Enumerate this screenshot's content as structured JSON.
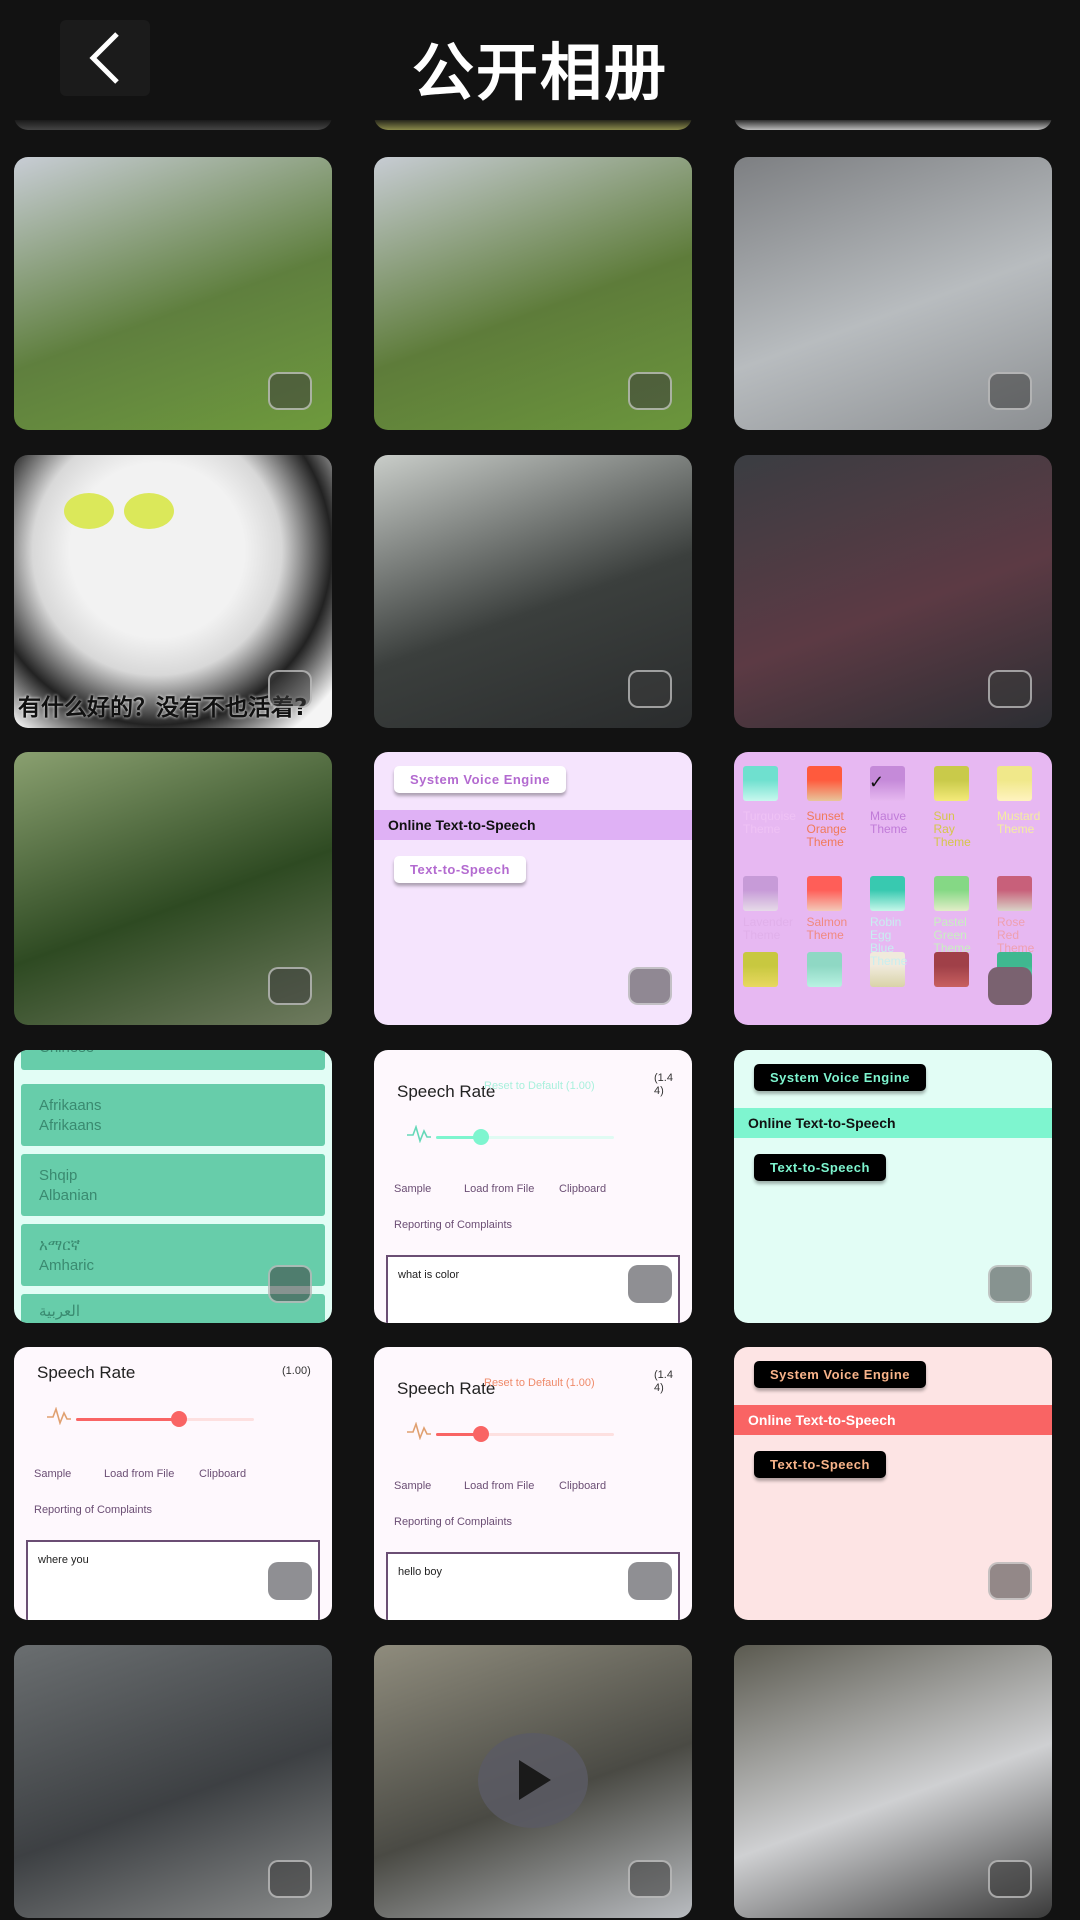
{
  "header": {
    "title": "公开相册",
    "back_icon": "chevron-left-icon"
  },
  "accent": {
    "mint": "#7ef5cf",
    "salmon": "#f96464",
    "mauve": "#dfb1f5"
  },
  "cells": [
    {
      "type": "photo",
      "desc": "girl-in-park-1",
      "colors": [
        "#c8cdd5",
        "#5f7f3e",
        "#6e9a3d"
      ]
    },
    {
      "type": "photo",
      "desc": "girl-in-park-2",
      "colors": [
        "#c7ccd3",
        "#5e7c3a",
        "#6b963c"
      ]
    },
    {
      "type": "photo",
      "desc": "bag-on-floor",
      "colors": [
        "#7d7f82",
        "#b8bcbf",
        "#8c8f92"
      ]
    },
    {
      "type": "meme",
      "caption": "有什么好的？没有不也活着?"
    },
    {
      "type": "photo",
      "desc": "keyboard-and-greens",
      "colors": [
        "#c9cdc9",
        "#3b3f3d",
        "#2a2c2d"
      ]
    },
    {
      "type": "photo",
      "desc": "grapes-container",
      "colors": [
        "#3a3d42",
        "#5c3a44",
        "#2c2e33"
      ]
    },
    {
      "type": "photo",
      "desc": "chopped-greens",
      "colors": [
        "#8aa070",
        "#2e4a22",
        "#6f7b5f"
      ]
    },
    {
      "type": "voice",
      "theme": "mauve",
      "system_voice": "System Voice Engine",
      "online": "Online Text-to-Speech",
      "tts": "Text-to-Speech"
    },
    {
      "type": "themes",
      "themes": [
        "Turquoise Theme",
        "Sunset Orange Theme",
        "Mauve Theme",
        "Sun Ray Theme",
        "Mustard Theme",
        "Lavender Theme",
        "Salmon Theme",
        "Robin Egg Blue Theme",
        "Pastel Green Theme",
        "Rose Red Theme"
      ]
    },
    {
      "type": "languages",
      "items": [
        "Chinese",
        "Afrikaans\nAfrikaans",
        "Shqip\nAlbanian",
        "አማርኛ\nAmharic",
        "العربية"
      ]
    },
    {
      "type": "rate",
      "theme": "mint",
      "title": "Speech Rate",
      "reset": "Reset to Default (1.00)",
      "value": "(1.4 4)",
      "rate": 1.44,
      "buttons": [
        "Sample",
        "Load from File",
        "Clipboard"
      ],
      "report": "Reporting of Complaints",
      "input": "what is color"
    },
    {
      "type": "voice",
      "theme": "mint",
      "system_voice": "System Voice Engine",
      "online": "Online Text-to-Speech",
      "tts": "Text-to-Speech"
    },
    {
      "type": "rate",
      "theme": "salmon-light",
      "title": "Speech Rate",
      "reset": "",
      "value": "(1.00)",
      "rate": 1.0,
      "buttons": [
        "Sample",
        "Load from File",
        "Clipboard"
      ],
      "report": "Reporting of Complaints",
      "input": "where you"
    },
    {
      "type": "rate",
      "theme": "salmon",
      "title": "Speech Rate",
      "reset": "Reset to Default (1.00)",
      "value": "(1.4 4)",
      "rate": 1.44,
      "buttons": [
        "Sample",
        "Load from File",
        "Clipboard"
      ],
      "report": "Reporting of Complaints",
      "input": "hello boy"
    },
    {
      "type": "voice",
      "theme": "salmon",
      "system_voice": "System Voice Engine",
      "online": "Online Text-to-Speech",
      "tts": "Text-to-Speech"
    },
    {
      "type": "photo",
      "desc": "subway-platform",
      "colors": [
        "#6a6e70",
        "#3d4043",
        "#8a8c8c"
      ]
    },
    {
      "type": "video",
      "desc": "shadow-on-ground-video",
      "colors": [
        "#8f8c7d",
        "#4a4a44",
        "#b9bcc0"
      ]
    },
    {
      "type": "photo",
      "desc": "shadow-on-sheet",
      "colors": [
        "#5b5a50",
        "#cfd0d2",
        "#3a3a3a"
      ]
    }
  ]
}
